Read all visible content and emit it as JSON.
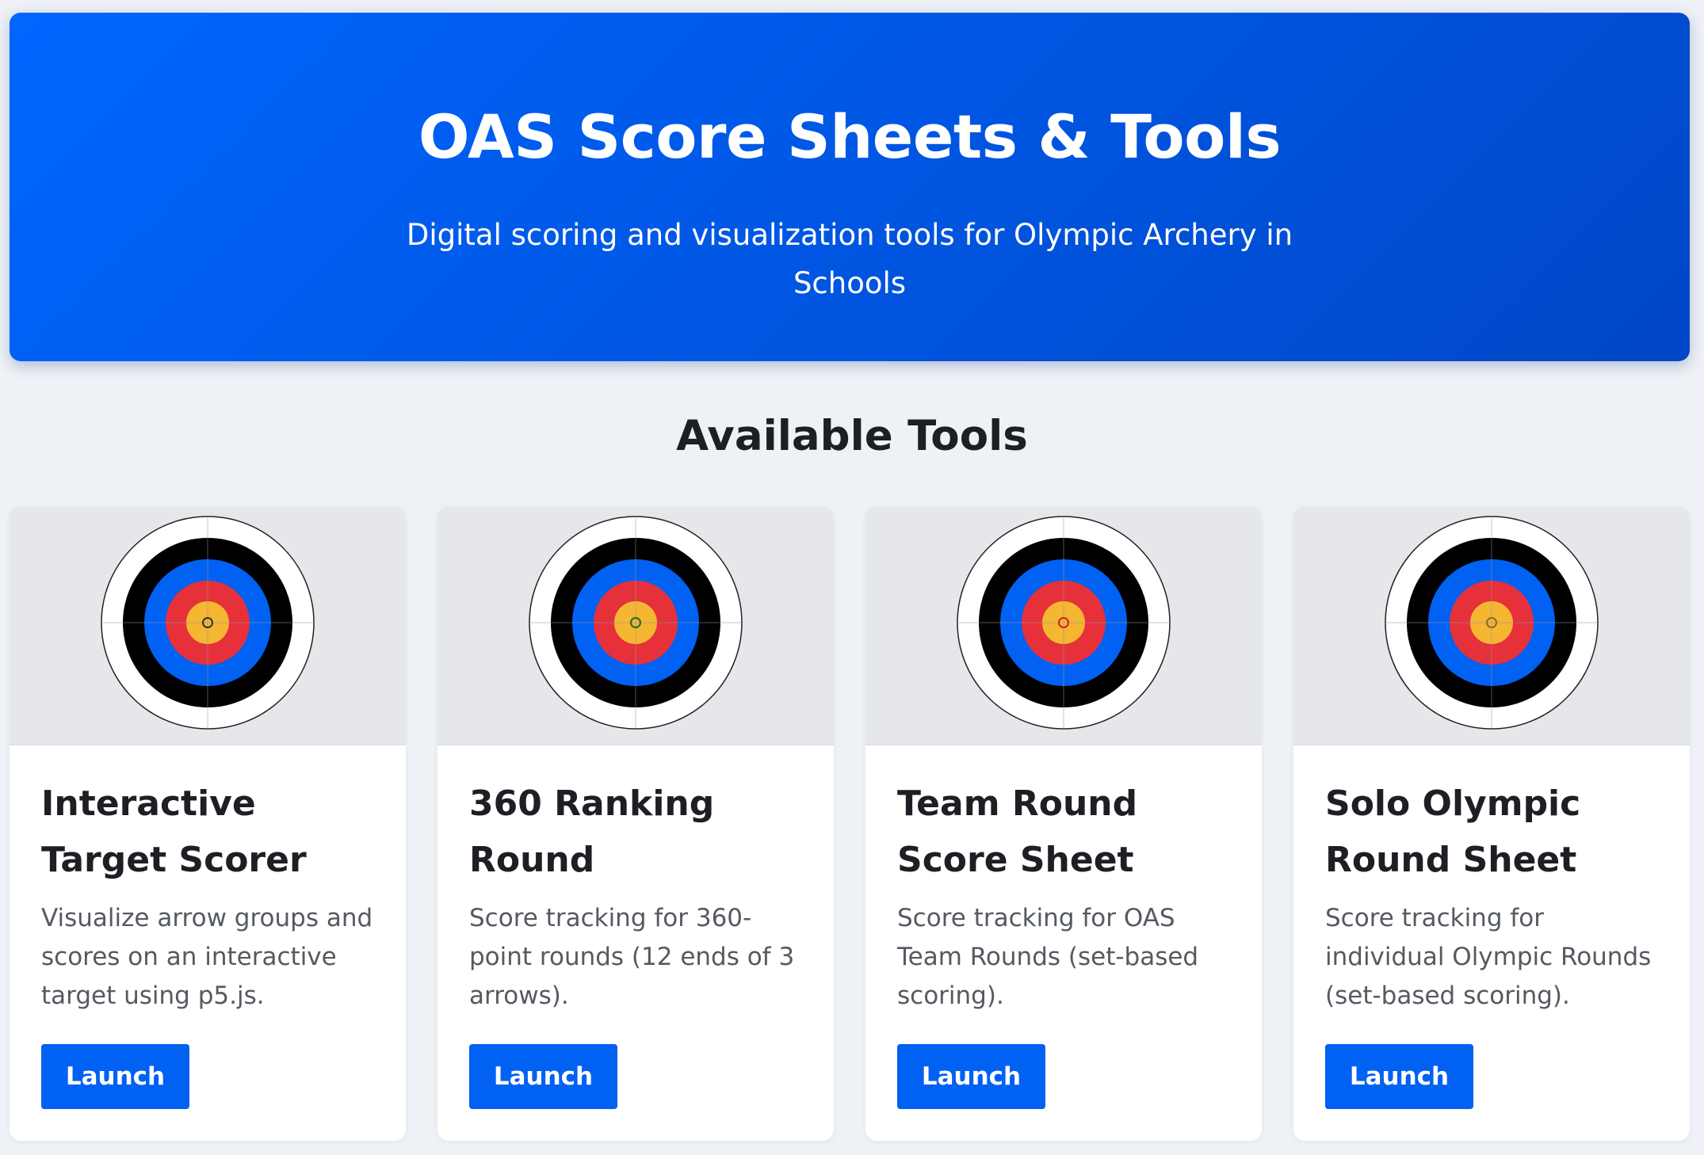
{
  "hero": {
    "title": "OAS Score Sheets & Tools",
    "subtitle": "Digital scoring and visualization tools for Olympic Archery in Schools"
  },
  "section": {
    "title": "Available Tools"
  },
  "colors": {
    "hero_blue": "#0061f2",
    "button_blue": "#0061f2",
    "target_white": "#ffffff",
    "target_black": "#000000",
    "target_blue": "#0061f2",
    "target_red": "#e6313a",
    "target_gold": "#f5b731"
  },
  "tools": [
    {
      "title": "Interactive Target Scorer",
      "description": "Visualize arrow groups and scores on an interactive target using p5.js.",
      "button_label": "Launch",
      "icon": "archery-target-icon",
      "center_ring_color": "#333333"
    },
    {
      "title": "360 Ranking Round",
      "description": "Score tracking for 360-point rounds (12 ends of 3 arrows).",
      "button_label": "Launch",
      "icon": "archery-target-icon",
      "center_ring_color": "#1f6b2e"
    },
    {
      "title": "Team Round Score Sheet",
      "description": "Score tracking for OAS Team Rounds (set-based scoring).",
      "button_label": "Launch",
      "icon": "archery-target-icon",
      "center_ring_color": "#d02030"
    },
    {
      "title": "Solo Olympic Round Sheet",
      "description": "Score tracking for individual Olympic Rounds (set-based scoring).",
      "button_label": "Launch",
      "icon": "archery-target-icon",
      "center_ring_color": "#8a6a2a"
    }
  ]
}
